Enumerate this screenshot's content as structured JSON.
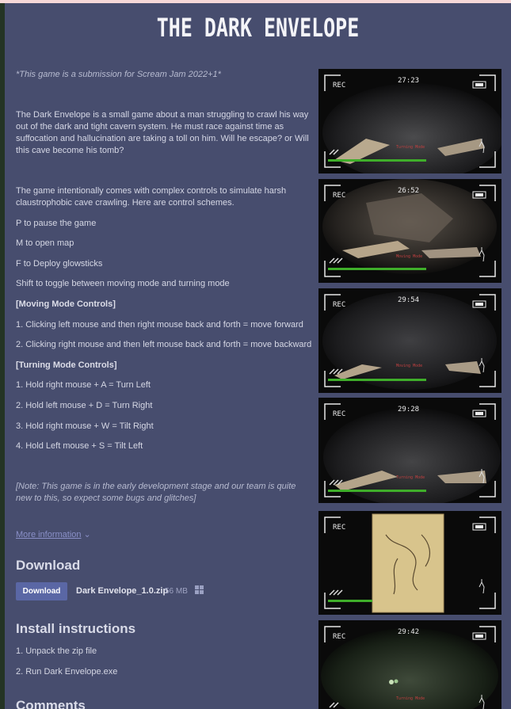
{
  "title": "THE DARK ENVELOPE",
  "submission_note": "*This game is a submission for Scream Jam 2022+1*",
  "description": "The Dark Envelope is a small game about a man struggling to crawl his way out of the dark and tight cavern system. He must race against time as suffocation and hallucination are taking a toll on him. Will he escape? or Will this cave become his tomb?",
  "controls_intro": "The game intentionally comes with complex controls to simulate harsh claustrophobic cave crawling. Here are control schemes.",
  "controls": {
    "pause": "P to pause the game",
    "map": "M to open map",
    "glowsticks": "F to Deploy glowsticks",
    "toggle": "Shift to toggle between moving mode and turning mode",
    "moving_header": "[Moving Mode Controls]",
    "moving": [
      "1. Clicking left mouse and then right mouse back and forth = move forward",
      "2. Clicking right mouse and then left mouse back and forth = move backward"
    ],
    "turning_header": "[Turning Mode Controls]",
    "turning": [
      "1. Hold right mouse + A = Turn Left",
      "2. Hold left mouse + D = Turn Right",
      "3. Hold right mouse + W = Tilt Right",
      "4. Hold Left mouse + S = Tilt Left"
    ]
  },
  "note": "[Note: This game is in the early development stage and our team is quite new to this, so expect some bugs and glitches]",
  "more_info": "More information",
  "download": {
    "heading": "Download",
    "button": "Download",
    "filename": "Dark Envelope_1.0.zip",
    "size": "56 MB",
    "platform_icon": "windows-icon"
  },
  "install": {
    "heading": "Install instructions",
    "steps": [
      "1. Unpack the zip file",
      "2. Run Dark Envelope.exe"
    ]
  },
  "comments_heading": "Comments",
  "screenshots": [
    {
      "rec": "REC",
      "time": "27:23",
      "mode": "Turning Mode"
    },
    {
      "rec": "REC",
      "time": "26:52",
      "mode": "Moving Mode"
    },
    {
      "rec": "REC",
      "time": "29:54",
      "mode": "Moving Mode"
    },
    {
      "rec": "REC",
      "time": "29:28",
      "mode": "Turning Mode"
    },
    {
      "rec": "REC",
      "time": "",
      "mode": ""
    },
    {
      "rec": "REC",
      "time": "29:42",
      "mode": "Turning Mode"
    }
  ],
  "colors": {
    "page_bg": "#474d6e",
    "link": "#8a90c8",
    "download_button": "#5a67a5",
    "health_bar": "#3fae2a"
  }
}
